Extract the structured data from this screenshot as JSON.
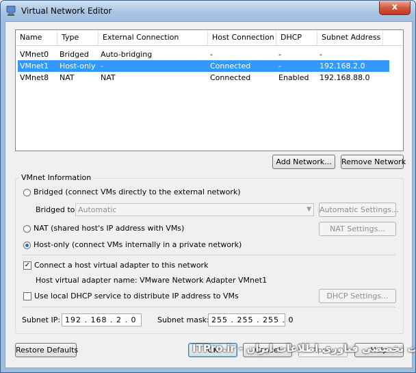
{
  "window": {
    "title": "Virtual Network Editor",
    "close_glyph": "x"
  },
  "table": {
    "columns": [
      "Name",
      "Type",
      "External Connection",
      "Host Connection",
      "DHCP",
      "Subnet Address"
    ],
    "rows": [
      [
        "VMnet0",
        "Bridged",
        "Auto-bridging",
        "-",
        "-",
        "-"
      ],
      [
        "VMnet1",
        "Host-only",
        "-",
        "Connected",
        "-",
        "192.168.2.0"
      ],
      [
        "VMnet8",
        "NAT",
        "NAT",
        "Connected",
        "Enabled",
        "192.168.88.0"
      ]
    ],
    "selected_row": 1
  },
  "buttons": {
    "add_network": "Add Network...",
    "remove_network": "Remove Network",
    "automatic_settings": "Automatic Settings...",
    "nat_settings": "NAT Settings...",
    "dhcp_settings": "DHCP Settings...",
    "restore_defaults": "Restore Defaults",
    "ok": "OK",
    "cancel": "Cancel",
    "apply": "Apply",
    "help": "Help"
  },
  "vmnet_info": {
    "group_label": "VMnet Information",
    "bridged_label": "Bridged (connect VMs directly to the external network)",
    "bridged_to_label": "Bridged to:",
    "bridged_to_value": "Automatic",
    "nat_label": "NAT (shared host's IP address with VMs)",
    "hostonly_label": "Host-only (connect VMs internally in a private network)",
    "selected_mode": "host-only",
    "connect_adapter_label": "Connect a host virtual adapter to this network",
    "connect_adapter_checked": true,
    "adapter_name_text": "Host virtual adapter name: VMware Network Adapter VMnet1",
    "dhcp_label": "Use local DHCP service to distribute IP address to VMs",
    "dhcp_checked": false,
    "subnet_ip_label": "Subnet IP:",
    "subnet_ip_value": "192 . 168 .  2  .  0",
    "subnet_mask_label": "Subnet mask:",
    "subnet_mask_value": "255 . 255 . 255 .  0"
  },
  "watermark": "ITPro.ir - وب سایت تخصصی فناوری اطلاعات ایران"
}
